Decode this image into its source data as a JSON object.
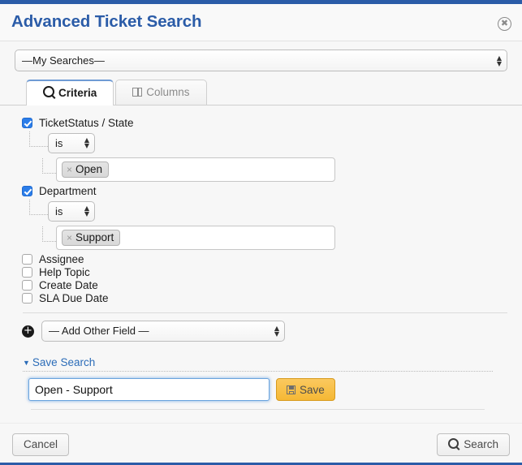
{
  "window": {
    "title": "Advanced Ticket Search",
    "close_icon": "close-circle-icon",
    "accent_color": "#2b5ca8",
    "title_color": "#2b5ca8"
  },
  "saved_search": {
    "selected": "—My Searches—",
    "icon": "chevron-updown-icon"
  },
  "tabs": [
    {
      "label": "Criteria",
      "icon": "search-icon",
      "active": true
    },
    {
      "label": "Columns",
      "icon": "columns-icon",
      "active": false
    }
  ],
  "criteria": {
    "fields": [
      {
        "label": "TicketStatus / State",
        "checked": true,
        "operator": "is",
        "chips": [
          {
            "label": "Open",
            "remove_icon": "close-x-icon"
          }
        ]
      },
      {
        "label": "Department",
        "checked": true,
        "operator": "is",
        "chips": [
          {
            "label": "Support",
            "remove_icon": "close-x-icon"
          }
        ]
      },
      {
        "label": "Assignee",
        "checked": false
      },
      {
        "label": "Help Topic",
        "checked": false
      },
      {
        "label": "Create Date",
        "checked": false
      },
      {
        "label": "SLA Due Date",
        "checked": false
      }
    ],
    "add_field": {
      "icon": "plus-circle-icon",
      "selected": "— Add Other Field —"
    }
  },
  "save_search": {
    "toggle_label": "Save Search",
    "toggle_caret": "caret-down-icon",
    "name_value": "Open - Support",
    "name_placeholder": "",
    "save_label": "Save",
    "save_icon": "floppy-disk-icon",
    "save_color": "#f5b835"
  },
  "footer": {
    "cancel_label": "Cancel",
    "search_label": "Search",
    "search_icon": "search-icon"
  }
}
